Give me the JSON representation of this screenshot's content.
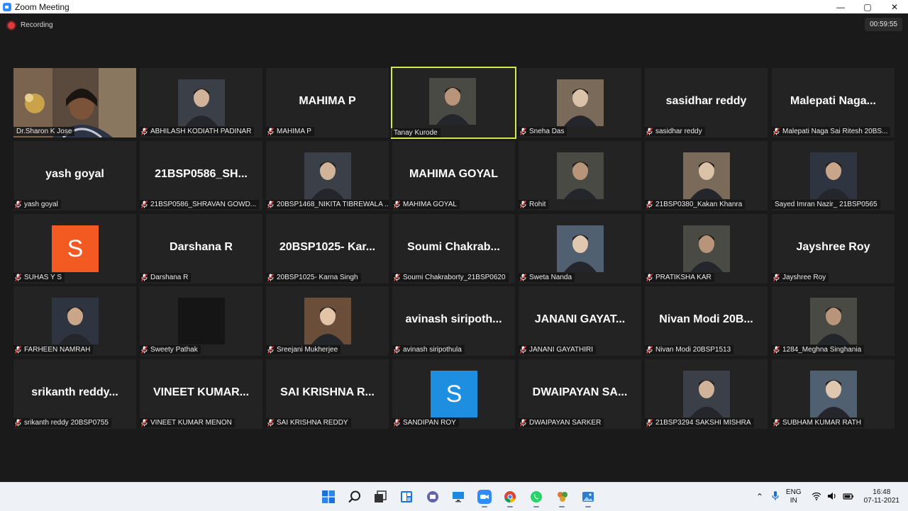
{
  "window": {
    "title": "Zoom Meeting",
    "controls": {
      "minimize": "—",
      "maximize": "▢",
      "close": "✕"
    }
  },
  "meeting": {
    "recording_label": "Recording",
    "timer": "00:59:55",
    "colors": {
      "active_speaker_border": "#d5e84a",
      "tile_bg": "#232323",
      "muted_mic": "#e03b3b"
    }
  },
  "participants": [
    {
      "label": "Dr.Sharon K Jose",
      "type": "video",
      "muted": false
    },
    {
      "label": "ABHILASH KODIATH PADINAR",
      "type": "photo",
      "muted": true
    },
    {
      "label": "MAHIMA P",
      "display": "MAHIMA P",
      "type": "name",
      "muted": true
    },
    {
      "label": "Tanay Kurode",
      "type": "photo",
      "muted": false,
      "active": true
    },
    {
      "label": "Sneha Das",
      "type": "photo",
      "muted": true
    },
    {
      "label": "sasidhar reddy",
      "display": "sasidhar reddy",
      "type": "name",
      "muted": true
    },
    {
      "label": "Malepati Naga Sai Ritesh 20BS...",
      "display": "Malepati  Naga...",
      "type": "name",
      "muted": true
    },
    {
      "label": "yash goyal",
      "display": "yash goyal",
      "type": "name",
      "muted": true
    },
    {
      "label": "21BSP0586_SHRAVAN GOWD...",
      "display": "21BSP0586_SH...",
      "type": "name",
      "muted": true
    },
    {
      "label": "20BSP1468_NIKITA TIBREWALA ...",
      "type": "photo",
      "muted": true
    },
    {
      "label": "MAHIMA GOYAL",
      "display": "MAHIMA GOYAL",
      "type": "name",
      "muted": true
    },
    {
      "label": "Rohit",
      "type": "photo",
      "muted": true
    },
    {
      "label": "21BSP0380_Kakan Khanra",
      "type": "photo",
      "muted": true
    },
    {
      "label": "Sayed Imran Nazir_ 21BSP0565",
      "type": "photo",
      "muted": false
    },
    {
      "label": "SUHAS Y S",
      "type": "avatar",
      "avatar_letter": "S",
      "avatar_color": "#f25a22",
      "muted": true
    },
    {
      "label": "Darshana R",
      "display": "Darshana R",
      "type": "name",
      "muted": true
    },
    {
      "label": "20BSP1025- Karna Singh",
      "display": "20BSP1025-  Kar...",
      "type": "name",
      "muted": true
    },
    {
      "label": "Soumi Chakraborty_21BSP0620",
      "display": "Soumi  Chakrab...",
      "type": "name",
      "muted": true
    },
    {
      "label": "Sweta Nanda",
      "type": "photo",
      "muted": true
    },
    {
      "label": "PRATIKSHA KAR",
      "type": "photo",
      "muted": true
    },
    {
      "label": "Jayshree Roy",
      "display": "Jayshree Roy",
      "type": "name",
      "muted": true
    },
    {
      "label": "FARHEEN NAMRAH",
      "type": "photo",
      "muted": true
    },
    {
      "label": "Sweety Pathak",
      "type": "blank",
      "muted": true
    },
    {
      "label": "Sreejani Mukherjee",
      "type": "photo",
      "muted": true
    },
    {
      "label": "avinash siripothula",
      "display": "avinash  siripoth...",
      "type": "name",
      "muted": true
    },
    {
      "label": "JANANI GAYATHIRI",
      "display": "JANANI  GAYAT...",
      "type": "name",
      "muted": true
    },
    {
      "label": "Nivan Modi 20BSP1513",
      "display": "Nivan  Modi  20B...",
      "type": "name",
      "muted": true
    },
    {
      "label": "1284_Meghna Singhania",
      "type": "photo",
      "muted": true
    },
    {
      "label": "srikanth reddy 20BSP0755",
      "display": "srikanth  reddy...",
      "type": "name",
      "muted": true
    },
    {
      "label": "VINEET KUMAR MENON",
      "display": "VINEET  KUMAR...",
      "type": "name",
      "muted": true
    },
    {
      "label": "SAI KRISHNA REDDY",
      "display": "SAI  KRISHNA  R...",
      "type": "name",
      "muted": true
    },
    {
      "label": "SANDIPAN ROY",
      "type": "avatar",
      "avatar_letter": "S",
      "avatar_color": "#1e8fe0",
      "muted": true
    },
    {
      "label": "DWAIPAYAN SARKER",
      "display": "DWAIPAYAN  SA...",
      "type": "name",
      "muted": true
    },
    {
      "label": "21BSP3294 SAKSHI MISHRA",
      "type": "photo",
      "muted": true
    },
    {
      "label": "SUBHAM KUMAR RATH",
      "type": "photo",
      "muted": true
    }
  ],
  "taskbar": {
    "apps": [
      "windows-start-icon",
      "search-icon",
      "task-view-icon",
      "widgets-icon",
      "teams-chat-icon",
      "desktop-icon",
      "zoom-icon",
      "chrome-icon",
      "whatsapp-icon",
      "games-icon",
      "photos-icon"
    ],
    "tray": {
      "lang_line1": "ENG",
      "lang_line2": "IN",
      "time": "16:48",
      "date": "07-11-2021"
    }
  }
}
